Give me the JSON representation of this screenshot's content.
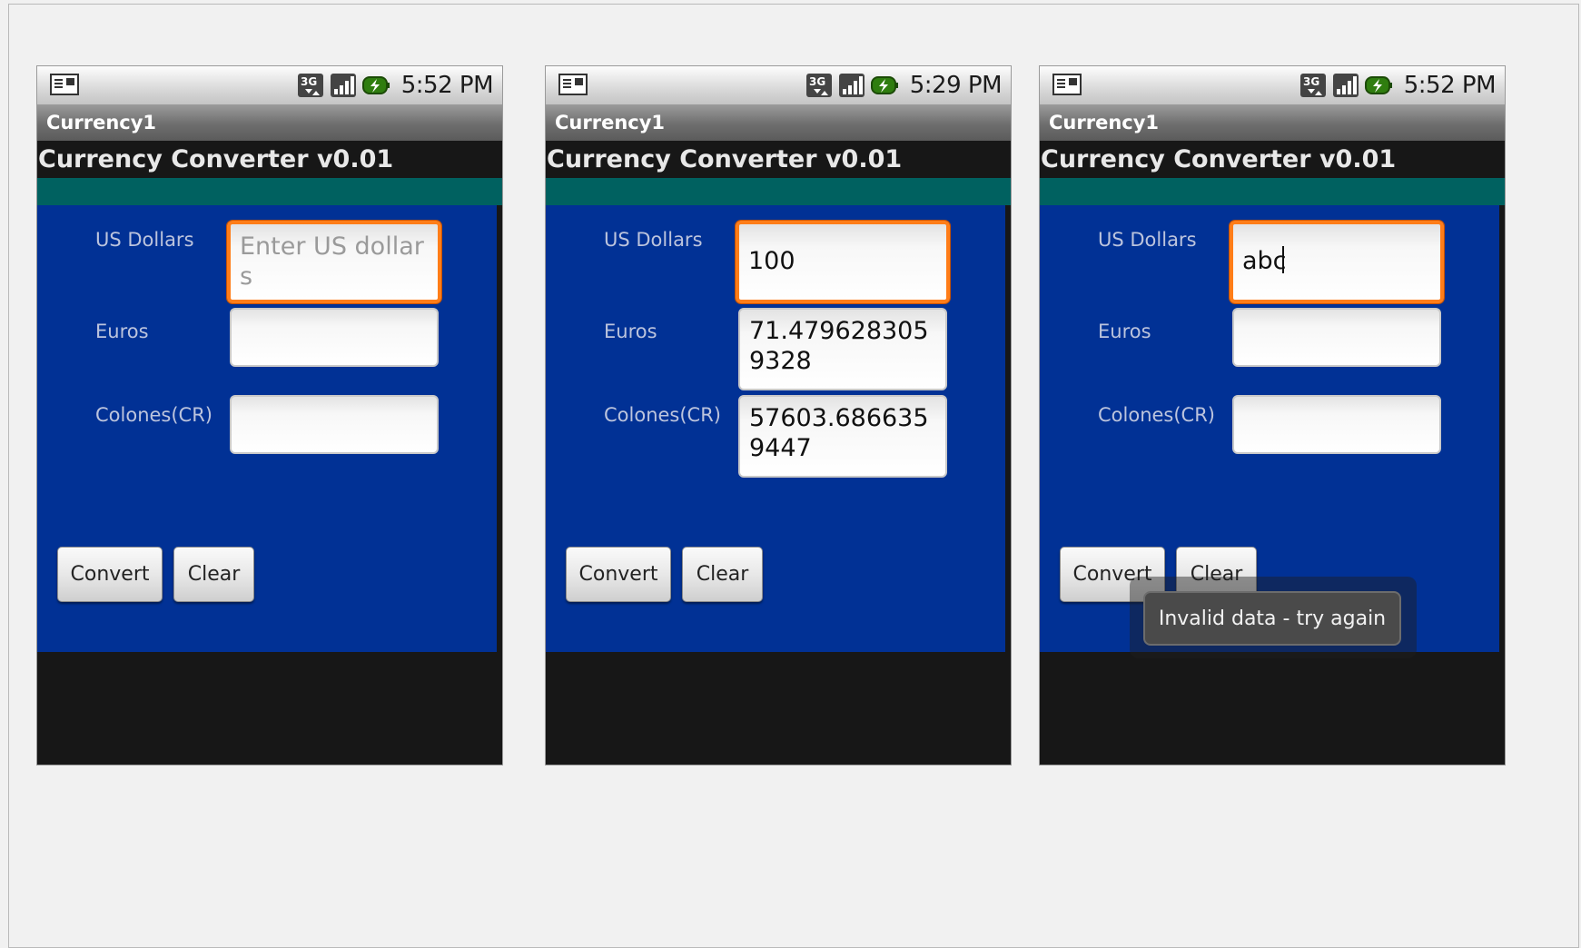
{
  "screens": [
    {
      "status": {
        "time": "5:52 PM"
      },
      "app_title": "Currency1",
      "heading": "Currency Converter v0.01",
      "fields": {
        "usd_label": "US Dollars",
        "usd_value": "",
        "usd_placeholder": "Enter US dollars",
        "euros_label": "Euros",
        "euros_value": "",
        "colones_label": "Colones(CR)",
        "colones_value": ""
      },
      "buttons": {
        "convert": "Convert",
        "clear": "Clear"
      }
    },
    {
      "status": {
        "time": "5:29 PM"
      },
      "app_title": "Currency1",
      "heading": "Currency Converter v0.01",
      "fields": {
        "usd_label": "US Dollars",
        "usd_value": "100",
        "euros_label": "Euros",
        "euros_value": "71.4796283059328",
        "colones_label": "Colones(CR)",
        "colones_value": "57603.6866359447"
      },
      "buttons": {
        "convert": "Convert",
        "clear": "Clear"
      }
    },
    {
      "status": {
        "time": "5:52 PM"
      },
      "app_title": "Currency1",
      "heading": "Currency Converter v0.01",
      "fields": {
        "usd_label": "US Dollars",
        "usd_value": "abc",
        "euros_label": "Euros",
        "euros_value": "",
        "colones_label": "Colones(CR)",
        "colones_value": ""
      },
      "buttons": {
        "convert": "Convert",
        "clear": "Clear"
      },
      "toast": "Invalid data - try again"
    }
  ],
  "icons": {
    "notification": "notification-icon",
    "network": "3g-data-icon",
    "signal": "signal-strength-icon",
    "battery": "battery-charging-icon"
  },
  "colors": {
    "panel_blue": "#013195",
    "teal_band": "#006160",
    "focus_orange": "#ff7d18",
    "background": "#171717"
  }
}
